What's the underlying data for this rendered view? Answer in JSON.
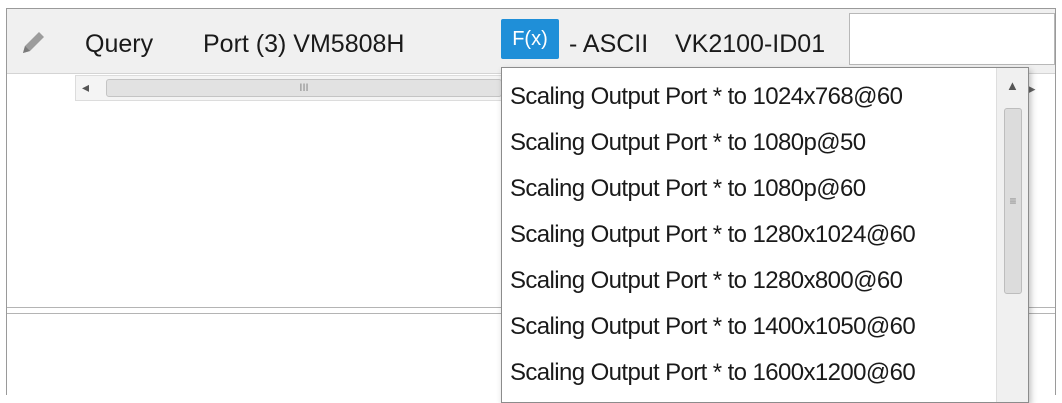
{
  "toolbar": {
    "edit_icon": "pencil-icon",
    "query_label": "Query",
    "port_label": "Port (3) VM5808H",
    "fx_button_label": "F(x)",
    "mode_label": "- ASCII",
    "device_label": "VK2100-ID01",
    "value_input": ""
  },
  "hscroll": {
    "left_arrow": "◂",
    "grip": "III"
  },
  "dropdown": {
    "items": [
      "Scaling Output Port * to 1024x768@60",
      "Scaling Output Port * to 1080p@50",
      "Scaling Output Port * to 1080p@60",
      "Scaling Output Port * to 1280x1024@60",
      "Scaling Output Port * to 1280x800@60",
      "Scaling Output Port * to 1400x1050@60",
      "Scaling Output Port * to 1600x1200@60"
    ],
    "scroll_up": "▲",
    "grip": "≡",
    "right_arrow": "▸"
  },
  "colors": {
    "fx_button": "#1f8fd8",
    "header_bg": "#f0f0f0"
  }
}
